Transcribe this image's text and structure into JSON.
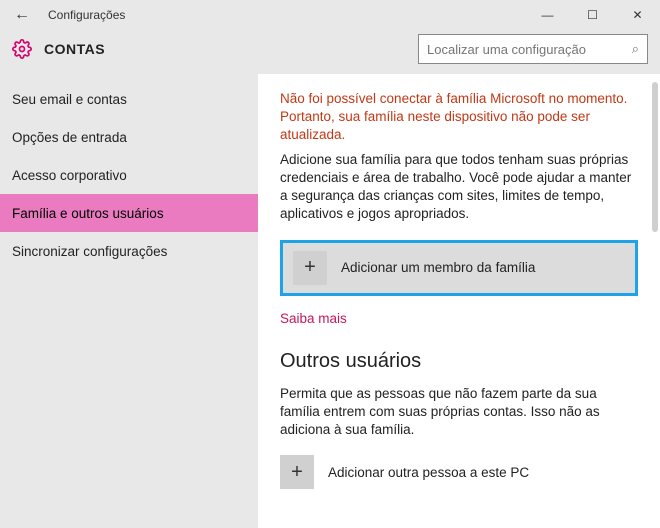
{
  "window": {
    "title": "Configurações"
  },
  "header": {
    "section": "CONTAS",
    "search_placeholder": "Localizar uma configuração"
  },
  "sidebar": {
    "items": [
      {
        "label": "Seu email e contas"
      },
      {
        "label": "Opções de entrada"
      },
      {
        "label": "Acesso corporativo"
      },
      {
        "label": "Família e outros usuários"
      },
      {
        "label": "Sincronizar configurações"
      }
    ],
    "active_index": 3
  },
  "main": {
    "error": "Não foi possível conectar à família Microsoft no momento. Portanto, sua família neste dispositivo não pode ser atualizada.",
    "family_desc": "Adicione sua família para que todos tenham suas próprias credenciais e área de trabalho. Você pode ajudar a manter a segurança das crianças com sites, limites de tempo, aplicativos e jogos apropriados.",
    "add_family_label": "Adicionar um membro da família",
    "learn_more": "Saiba mais",
    "others_heading": "Outros usuários",
    "others_desc": "Permita que as pessoas que não fazem parte da sua família entrem com suas próprias contas. Isso não as adiciona à sua família.",
    "add_other_label": "Adicionar outra pessoa a este PC"
  },
  "glyphs": {
    "back": "←",
    "minimize": "—",
    "maximize": "☐",
    "close": "✕",
    "plus": "+",
    "search": "⌕"
  }
}
